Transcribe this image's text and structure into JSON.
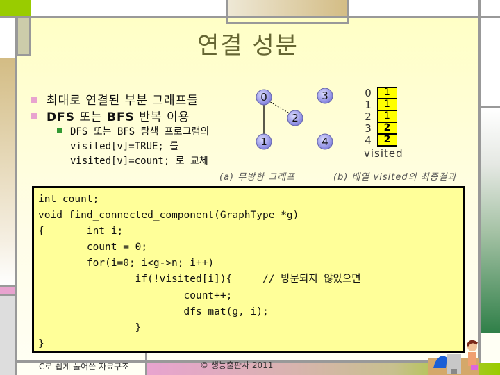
{
  "title": "연결 성분",
  "bullets": [
    {
      "text": "최대로 연결된 부분 그래프들"
    },
    {
      "text_parts": [
        "DFS",
        " 또는 ",
        "BFS",
        " 반복 이용"
      ]
    }
  ],
  "sub_bullet": {
    "lines": [
      "DFS 또는 BFS 탐색 프로그램의",
      "visited[v]=TRUE; 를",
      "visited[v]=count; 로 교체"
    ]
  },
  "graph": {
    "nodes": [
      "0",
      "1",
      "2",
      "3",
      "4"
    ],
    "edges": [
      [
        "0",
        "1",
        "solid"
      ],
      [
        "0",
        "2",
        "dashed"
      ]
    ],
    "caption": "(a) 무방향 그래프"
  },
  "visited_array": {
    "indices": [
      "0",
      "1",
      "2",
      "3",
      "4"
    ],
    "values": [
      "1",
      "1",
      "1",
      "2",
      "2"
    ],
    "label": "visited",
    "caption": "(b) 배열 visited의 최종결과",
    "cell_color": "#ffff00"
  },
  "code": {
    "lines": [
      "int count;",
      "void find_connected_component(GraphType *g)",
      "{       int i;",
      "        count = 0;",
      "        for(i=0; i<g->n; i++)",
      "                if(!visited[i]){     // 방문되지 않았으면",
      "                        count++;",
      "                        dfs_mat(g, i);",
      "                }",
      "}"
    ]
  },
  "footer": {
    "book": "C로 쉽게 풀어쓴 자료구조",
    "copyright": "© 생능출판사 2011"
  },
  "colors": {
    "title": "#666633",
    "bullet": "#e8a3cf",
    "sub_bullet": "#339933",
    "code_bg": "#ffff99",
    "node_fill": "#9999ee"
  }
}
